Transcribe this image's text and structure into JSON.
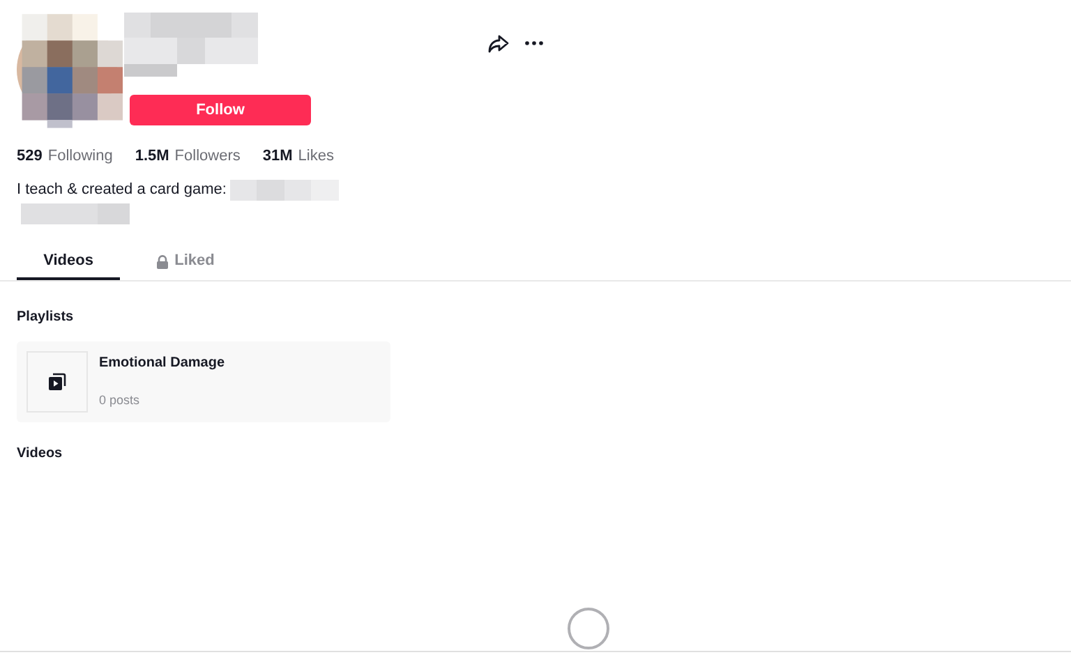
{
  "profile": {
    "follow_button": "Follow"
  },
  "stats": [
    {
      "count": "529",
      "caption": "Following"
    },
    {
      "count": "1.5M",
      "caption": "Followers"
    },
    {
      "count": "31M",
      "caption": "Likes"
    }
  ],
  "bio": "I teach & created a card game:",
  "tabs": [
    {
      "label": "Videos",
      "selected": true,
      "locked": false
    },
    {
      "label": "Liked",
      "selected": false,
      "locked": true
    }
  ],
  "playlists": {
    "heading": "Playlists",
    "items": [
      {
        "title": "Emotional Damage",
        "count": "0 posts"
      }
    ]
  },
  "videos": {
    "heading": "Videos"
  }
}
